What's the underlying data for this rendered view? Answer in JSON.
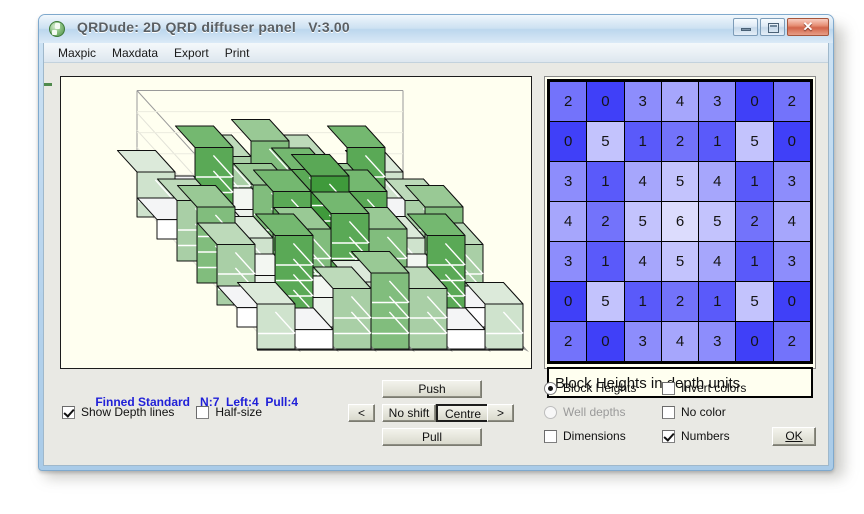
{
  "window": {
    "title": "QRDude: 2D QRD diffuser panel   V:3.00",
    "icon": "qrdude-app-icon",
    "minimize_label": "",
    "maximize_label": "",
    "close_label": "✕"
  },
  "menu": {
    "items": [
      {
        "label": "Maxpic"
      },
      {
        "label": "Maxdata"
      },
      {
        "label": "Export"
      },
      {
        "label": "Print"
      }
    ]
  },
  "grid": {
    "caption": "Block Heights in depth units",
    "rows": [
      [
        2,
        0,
        3,
        4,
        3,
        0,
        2
      ],
      [
        0,
        5,
        1,
        2,
        1,
        5,
        0
      ],
      [
        3,
        1,
        4,
        5,
        4,
        1,
        3
      ],
      [
        4,
        2,
        5,
        6,
        5,
        2,
        4
      ],
      [
        3,
        1,
        4,
        5,
        4,
        1,
        3
      ],
      [
        0,
        5,
        1,
        2,
        1,
        5,
        0
      ],
      [
        2,
        0,
        3,
        4,
        3,
        0,
        2
      ]
    ],
    "cell_colors": {
      "0": "#4040f8",
      "1": "#5a5afa",
      "2": "#7373fb",
      "3": "#8d8dfc",
      "4": "#a6a6fc",
      "5": "#c3c3fd",
      "6": "#dcdcfd"
    },
    "max_value": 6
  },
  "status": {
    "design": "Finned Standard",
    "n_label": "N:7",
    "left_label": "Left:4",
    "pull_label": "Pull:4",
    "color": "#2020d8"
  },
  "left_controls": {
    "show_depth_lines": {
      "label": "Show Depth lines",
      "checked": true
    },
    "half_size": {
      "label": "Half-size",
      "checked": false
    }
  },
  "shift_controls": {
    "push": "Push",
    "pull": "Pull",
    "left_arrow": "<",
    "right_arrow": ">",
    "no_shift": "No shift",
    "centre": "Centre"
  },
  "right_controls": {
    "block_heights": {
      "label": "Block Heights",
      "selected": true
    },
    "well_depths": {
      "label": "Well depths",
      "selected": false
    },
    "dimensions": {
      "label": "Dimensions",
      "checked": false
    },
    "invert_colors": {
      "label": "Invert colors",
      "checked": false
    },
    "no_color": {
      "label": "No color",
      "checked": false
    },
    "numbers": {
      "label": "Numbers",
      "checked": true
    },
    "ok": "OK"
  },
  "plot3d": {
    "background": "#fffff0",
    "axis_color": "#9a9a9a",
    "depth_line_color": "#ffffff",
    "shadow_color": "#7a7a7a",
    "rows": [
      [
        2,
        0,
        3,
        4,
        3,
        0,
        2
      ],
      [
        0,
        5,
        1,
        2,
        1,
        5,
        0
      ],
      [
        3,
        1,
        4,
        5,
        4,
        1,
        3
      ],
      [
        4,
        2,
        5,
        6,
        5,
        2,
        4
      ],
      [
        3,
        1,
        4,
        5,
        4,
        1,
        3
      ],
      [
        0,
        5,
        1,
        2,
        1,
        5,
        0
      ],
      [
        2,
        0,
        3,
        4,
        3,
        0,
        2
      ]
    ],
    "block_colors": {
      "0": {
        "front": "#ffffff",
        "side": "#e8eaec",
        "top": "#f4f5f6"
      },
      "1": {
        "front": "#edf3ec",
        "side": "#d7e2d6",
        "top": "#f3f7f2"
      },
      "2": {
        "front": "#cfe3cd",
        "side": "#b7d2b5",
        "top": "#dceada"
      },
      "3": {
        "front": "#a9cfa6",
        "side": "#92bd8f",
        "top": "#bddaba"
      },
      "4": {
        "front": "#81bd7d",
        "side": "#6aa867",
        "top": "#99c995"
      },
      "5": {
        "front": "#5aa956",
        "side": "#479443",
        "top": "#74b870"
      },
      "6": {
        "front": "#3f9a3b",
        "side": "#2f842c",
        "top": "#5aa856"
      }
    }
  }
}
